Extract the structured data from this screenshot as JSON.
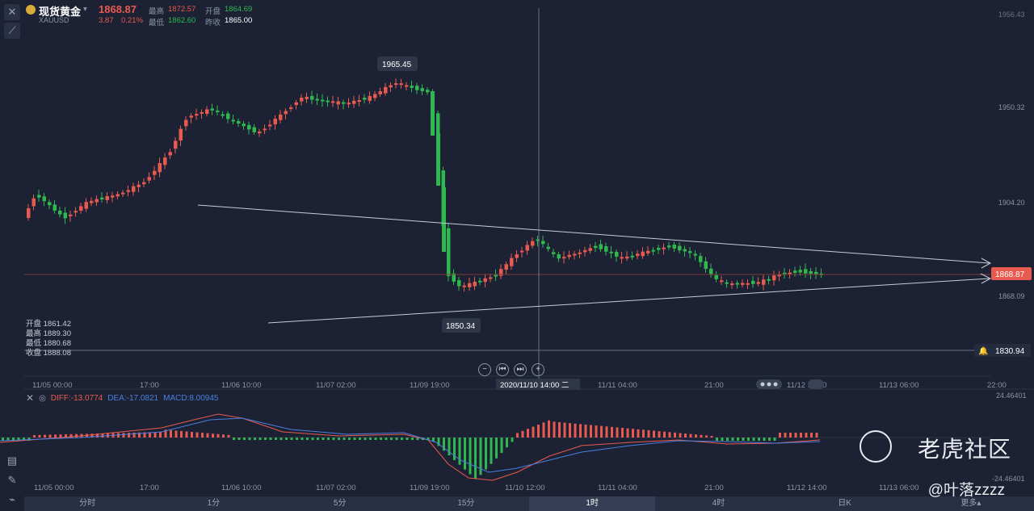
{
  "header": {
    "symbol_name": "现货黄金",
    "symbol_code": "XAUUSD",
    "price": "1868.87",
    "change": "3.87",
    "change_pct": "0.21%",
    "high_label": "最高",
    "high_value": "1872.57",
    "open_label": "开盘",
    "open_value": "1864.69",
    "low_label": "最低",
    "low_value": "1862.60",
    "prev_close_label": "昨收",
    "prev_close_value": "1865.00"
  },
  "price_axis": {
    "ticks": [
      "1956.43",
      "1950.32",
      "1904.20",
      "1868.09"
    ],
    "current_price": "1868.87",
    "alert_price": "1830.94"
  },
  "annotations": {
    "peak_label": "1965.45",
    "low_label": "1850.34",
    "crosshair_time": "2020/11/10 14:00 二"
  },
  "ohlc_panel": {
    "open": "开盘 1861.42",
    "high": "最高 1889.30",
    "low": "最低 1880.68",
    "close": "收盘 1888.08"
  },
  "main_time_axis": [
    "11/05 00:00",
    "17:00",
    "11/06 10:00",
    "11/07 02:00",
    "11/09 19:00",
    "11/11 04:00",
    "21:00",
    "11/12 14:00",
    "11/13 06:00",
    "22:00"
  ],
  "macd": {
    "diff": "DIFF:-13.0774",
    "dea": "DEA:-17.0821",
    "macd": "MACD:8.00945",
    "axis_top": "24.46401",
    "axis_bottom": "-24.46401",
    "time_axis": [
      "11/05 00:00",
      "17:00",
      "11/06 10:00",
      "11/07 02:00",
      "11/09 19:00",
      "11/10 12:00",
      "11/11 04:00",
      "21:00",
      "11/12 14:00",
      "11/13 06:00"
    ]
  },
  "timeframes": [
    "分时",
    "1分",
    "5分",
    "15分",
    "1时",
    "4时",
    "日K",
    "更多"
  ],
  "active_timeframe": "1时",
  "watermark": {
    "brand": "老虎社区",
    "handle": "@叶落zzzz"
  },
  "colors": {
    "up": "#e85a4f",
    "down": "#2fb84f",
    "bg": "#1c2233",
    "diff_line": "#e85a4f",
    "dea_line": "#4a7fe0"
  },
  "icons": {
    "close": "close-icon",
    "draw": "draw-tool-icon",
    "dropdown": "chevron-down-icon",
    "bell": "bell-icon"
  }
}
